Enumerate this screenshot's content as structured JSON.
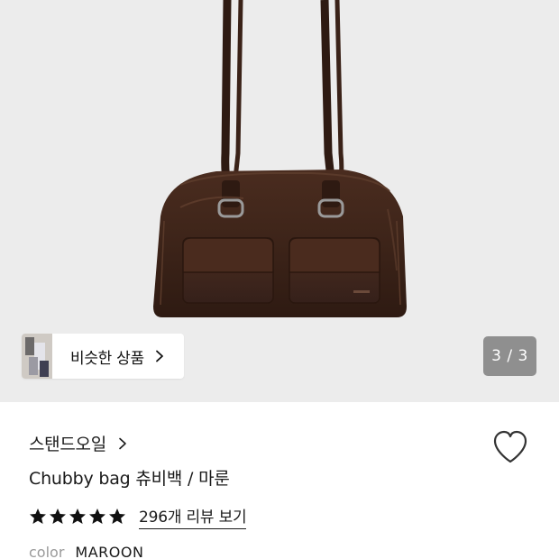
{
  "gallery": {
    "similar_label": "비슷한 상품",
    "counter": "3 / 3"
  },
  "product": {
    "brand": "스탠드오일",
    "title": "Chubby bag 츄비백 / 마룬",
    "rating": 5,
    "review_link": "296개 리뷰 보기",
    "color_label": "color",
    "color_value": "MAROON"
  },
  "colors": {
    "bag": "#3d2419",
    "hero_bg": "#ececec",
    "counter_bg": "#8f8f8f"
  },
  "icons": [
    "chevron-right-icon",
    "heart-icon",
    "star-icon"
  ]
}
